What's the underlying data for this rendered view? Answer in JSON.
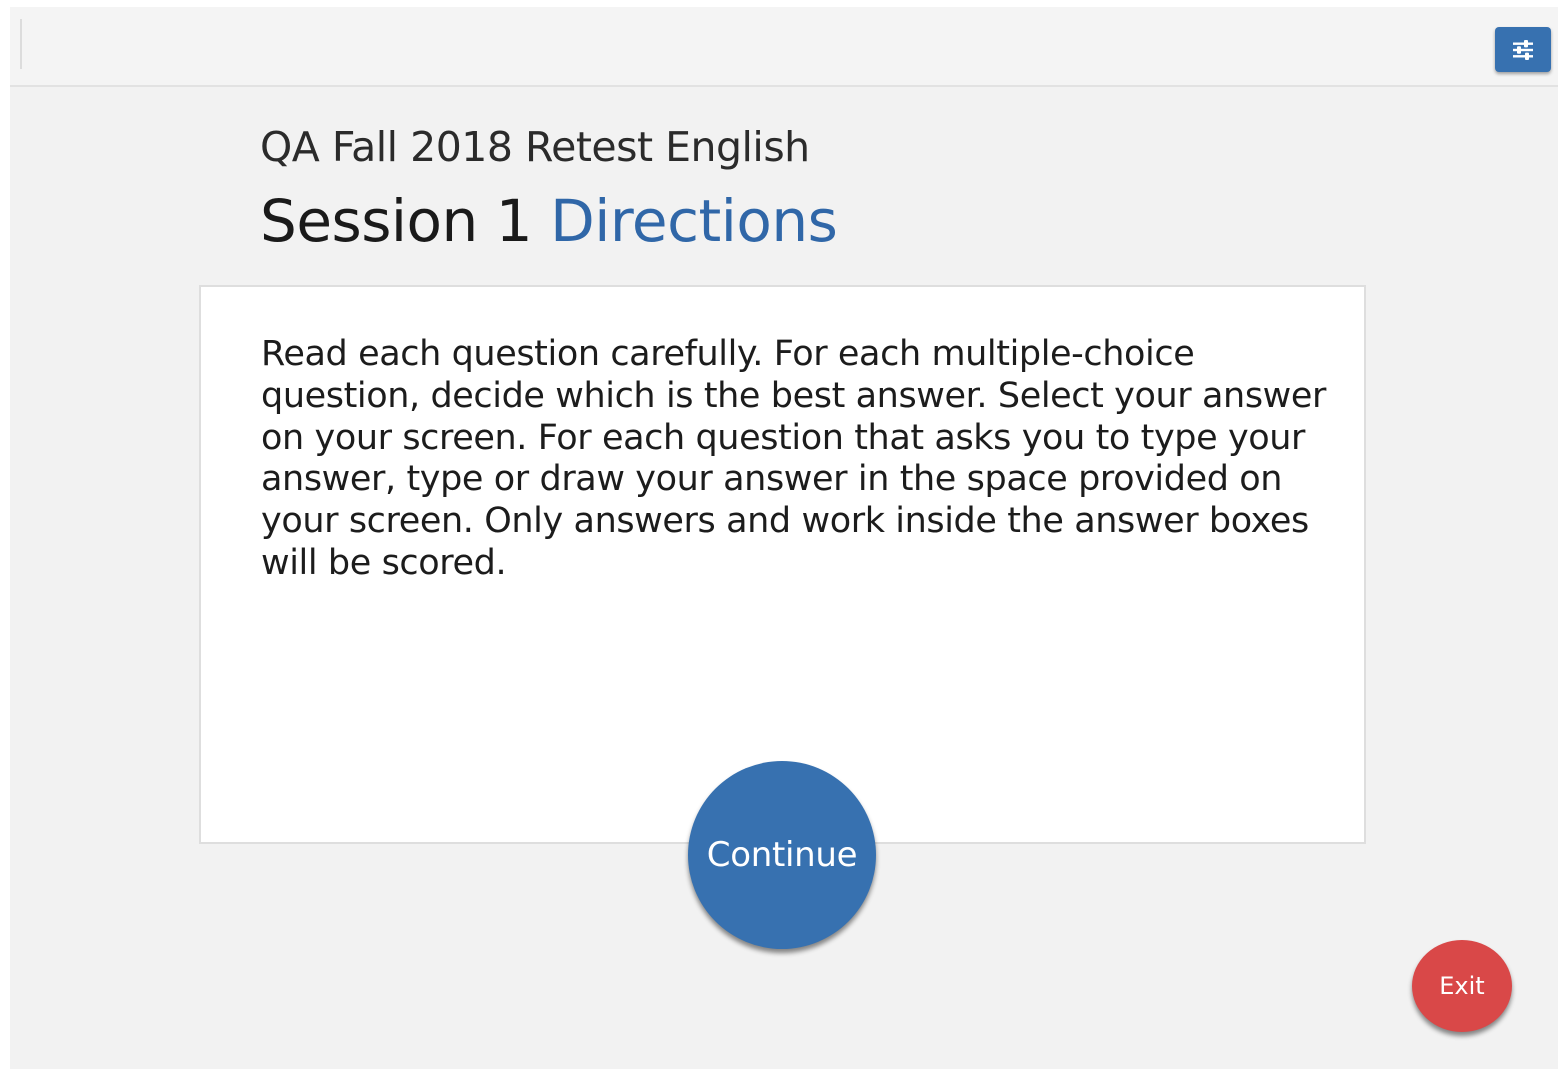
{
  "toolbar": {
    "settings_icon": "sliders-icon",
    "settings_button_color": "#3771b0"
  },
  "header": {
    "test_name": "QA Fall 2018 Retest English",
    "session_label": "Session 1",
    "session_accent": "Directions",
    "accent_color": "#3067a8"
  },
  "directions": {
    "text": "Read each question carefully. For each multiple-choice question, decide which is the best answer. Select your answer on your screen. For each question that asks you to type your answer, type or draw your answer in the space provided on your screen. Only answers and work inside the answer boxes will be scored."
  },
  "actions": {
    "continue_label": "Continue",
    "continue_color": "#3771b0",
    "exit_label": "Exit",
    "exit_color": "#d94848"
  }
}
